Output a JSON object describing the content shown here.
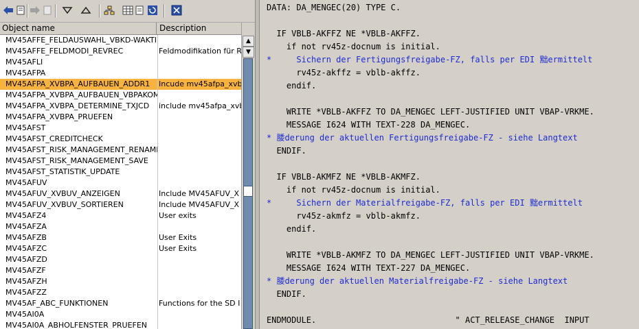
{
  "toolbar": {
    "buttons": [
      {
        "icon": "back-arrow-icon",
        "enabled": true
      },
      {
        "icon": "document-icon",
        "enabled": true
      },
      {
        "icon": "forward-arrow-icon",
        "enabled": false
      },
      {
        "icon": "document-icon",
        "enabled": false
      },
      {
        "icon": "filter-down-icon",
        "enabled": true
      },
      {
        "icon": "filter-up-icon",
        "enabled": true
      },
      {
        "icon": "hierarchy-icon",
        "enabled": true
      },
      {
        "icon": "grid-icon",
        "enabled": true
      },
      {
        "icon": "refresh-icon",
        "enabled": true
      },
      {
        "icon": "close-icon",
        "enabled": true
      }
    ]
  },
  "table": {
    "headers": {
      "name": "Object name",
      "description": "Description"
    },
    "rows": [
      {
        "name": "MV45AFFE_FELDAUSWAHL_VBKD-WAKTI",
        "description": ""
      },
      {
        "name": "MV45AFFE_FELDMODI_REVREC",
        "description": "Feldmodifikation für R"
      },
      {
        "name": "MV45AFLI",
        "description": ""
      },
      {
        "name": "MV45AFPA",
        "description": ""
      },
      {
        "name": "MV45AFPA_XVBPA_AUFBAUEN_ADDR1",
        "description": "Incude mv45afpa_xvb",
        "selected": true
      },
      {
        "name": "MV45AFPA_XVBPA_AUFBAUEN_VBPAKOM",
        "description": ""
      },
      {
        "name": "MV45AFPA_XVBPA_DETERMINE_TXJCD",
        "description": "include mv45afpa_xvb"
      },
      {
        "name": "MV45AFPA_XVBPA_PRUEFEN",
        "description": ""
      },
      {
        "name": "MV45AFST",
        "description": ""
      },
      {
        "name": "MV45AFST_CREDITCHECK",
        "description": ""
      },
      {
        "name": "MV45AFST_RISK_MANAGEMENT_RENAME",
        "description": ""
      },
      {
        "name": "MV45AFST_RISK_MANAGEMENT_SAVE",
        "description": ""
      },
      {
        "name": "MV45AFST_STATISTIK_UPDATE",
        "description": ""
      },
      {
        "name": "MV45AFUV",
        "description": ""
      },
      {
        "name": "MV45AFUV_XVBUV_ANZEIGEN",
        "description": "Include MV45AFUV_X"
      },
      {
        "name": "MV45AFUV_XVBUV_SORTIEREN",
        "description": "Include MV45AFUV_X"
      },
      {
        "name": "MV45AFZ4",
        "description": "User exits"
      },
      {
        "name": "MV45AFZA",
        "description": ""
      },
      {
        "name": "MV45AFZB",
        "description": "User Exits"
      },
      {
        "name": "MV45AFZC",
        "description": "User Exits"
      },
      {
        "name": "MV45AFZD",
        "description": ""
      },
      {
        "name": "MV45AFZF",
        "description": ""
      },
      {
        "name": "MV45AFZH",
        "description": ""
      },
      {
        "name": "MV45AFZZ",
        "description": ""
      },
      {
        "name": "MV45AF_ABC_FUNKTIONEN",
        "description": "Functions for the SD I"
      },
      {
        "name": "MV45AI0A",
        "description": ""
      },
      {
        "name": "MV45AI0A_ABHOLFENSTER_PRUEFEN",
        "description": ""
      }
    ]
  },
  "code": {
    "lines": [
      {
        "text": "DATA: DA_MENGEC(20) TYPE C.",
        "comment": false
      },
      {
        "text": "",
        "comment": false
      },
      {
        "text": "  IF VBLB-AKFFZ NE *VBLB-AKFFZ.",
        "comment": false
      },
      {
        "text": "    if not rv45z-docnum is initial.",
        "comment": false
      },
      {
        "text": "*     Sichern der Fertigungsfreigabe-FZ, falls per EDI 黜ermittelt",
        "comment": true
      },
      {
        "text": "      rv45z-akffz = vblb-akffz.",
        "comment": false
      },
      {
        "text": "    endif.",
        "comment": false
      },
      {
        "text": "",
        "comment": false
      },
      {
        "text": "    WRITE *VBLB-AKFFZ TO DA_MENGEC LEFT-JUSTIFIED UNIT VBAP-VRKME.",
        "comment": false
      },
      {
        "text": "    MESSAGE I624 WITH TEXT-228 DA_MENGEC.",
        "comment": false
      },
      {
        "text": "* 腇derung der aktuellen Fertigungsfreigabe-FZ - siehe Langtext",
        "comment": true
      },
      {
        "text": "  ENDIF.",
        "comment": false
      },
      {
        "text": "",
        "comment": false
      },
      {
        "text": "  IF VBLB-AKMFZ NE *VBLB-AKMFZ.",
        "comment": false
      },
      {
        "text": "    if not rv45z-docnum is initial.",
        "comment": false
      },
      {
        "text": "*     Sichern der Materialfreigabe-FZ, falls per EDI 黜ermittelt",
        "comment": true
      },
      {
        "text": "      rv45z-akmfz = vblb-akmfz.",
        "comment": false
      },
      {
        "text": "    endif.",
        "comment": false
      },
      {
        "text": "",
        "comment": false
      },
      {
        "text": "    WRITE *VBLB-AKMFZ TO DA_MENGEC LEFT-JUSTIFIED UNIT VBAP-VRKME.",
        "comment": false
      },
      {
        "text": "    MESSAGE I624 WITH TEXT-227 DA_MENGEC.",
        "comment": false
      },
      {
        "text": "* 腇derung der aktuellen Materialfreigabe-FZ - siehe Langtext",
        "comment": true
      },
      {
        "text": "  ENDIF.",
        "comment": false
      },
      {
        "text": "",
        "comment": false
      },
      {
        "text": "ENDMODULE.                            \" ACT_RELEASE_CHANGE  INPUT",
        "comment": false
      }
    ]
  },
  "scrollbar": {
    "up_label": "▲",
    "down_label": "▼"
  }
}
